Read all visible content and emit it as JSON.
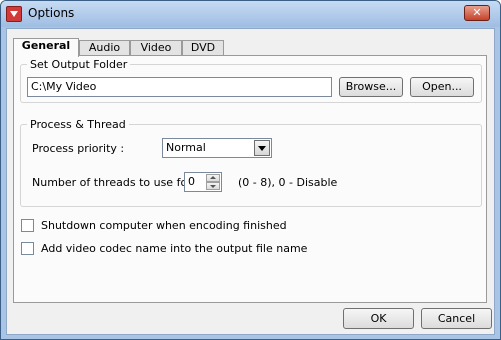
{
  "window": {
    "title": "Options",
    "close_glyph": "✕",
    "icon": "app-logo-icon"
  },
  "tabs": [
    {
      "label": "General",
      "active": true
    },
    {
      "label": "Audio",
      "active": false
    },
    {
      "label": "Video",
      "active": false
    },
    {
      "label": "DVD",
      "active": false
    }
  ],
  "output_folder": {
    "group_label": "Set Output Folder",
    "path_value": "C:\\My Video",
    "browse_label": "Browse...",
    "open_label": "Open..."
  },
  "process_thread": {
    "group_label": "Process & Thread",
    "priority_label": "Process priority :",
    "priority_value": "Normal",
    "threads_label": "Number of threads to use for",
    "threads_value": "0",
    "threads_hint": "(0 - 8),  0 - Disable"
  },
  "options": {
    "shutdown_label": "Shutdown computer when encoding finished",
    "shutdown_checked": false,
    "codec_name_label": "Add video codec name into the output file name",
    "codec_name_checked": false
  },
  "footer": {
    "ok_label": "OK",
    "cancel_label": "Cancel"
  },
  "colors": {
    "frame": "#a9c4e4",
    "client": "#f0f0f0",
    "tab_page": "#fbfbfb",
    "close_button": "#c6422a"
  }
}
